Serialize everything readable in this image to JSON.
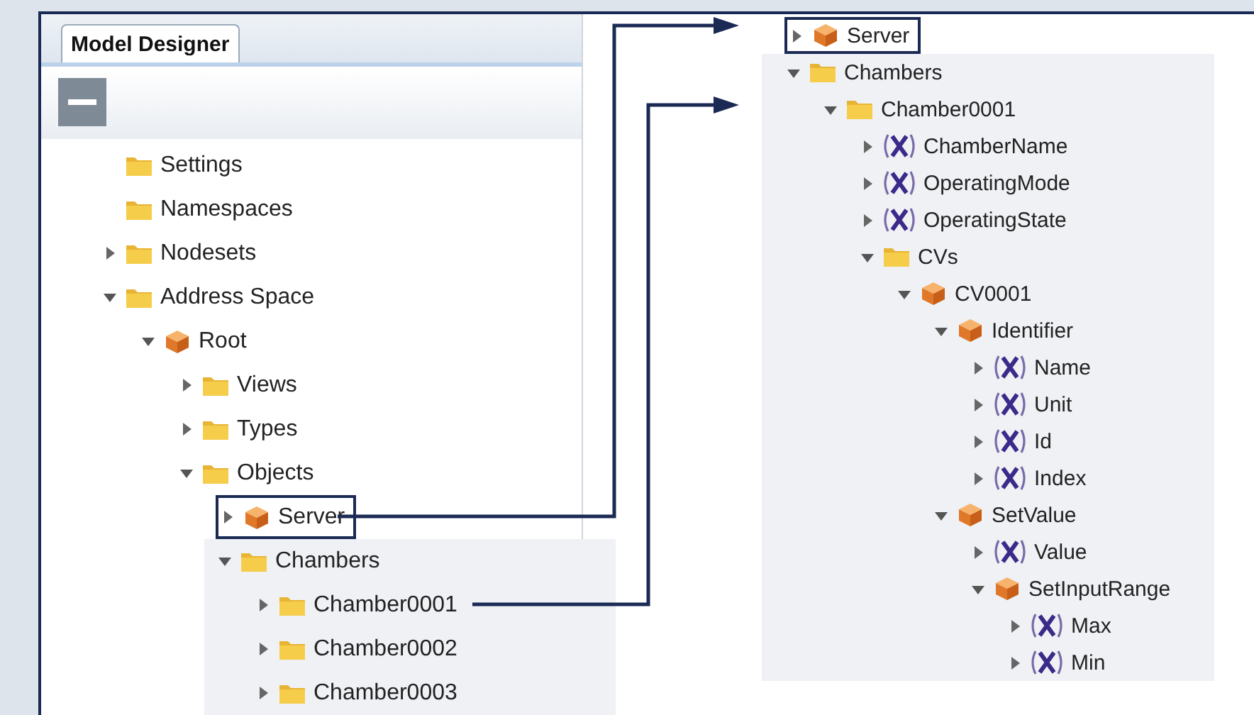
{
  "left_panel": {
    "tab": {
      "label": "Model Designer",
      "selected": true
    },
    "tree": [
      {
        "label": "Settings",
        "kind": "folder"
      },
      {
        "label": "Namespaces",
        "kind": "folder"
      },
      {
        "label": "Nodesets",
        "kind": "folder",
        "expanded": false
      },
      {
        "label": "Address Space",
        "kind": "folder",
        "expanded": true,
        "children": [
          {
            "label": "Root",
            "kind": "object",
            "expanded": true,
            "children": [
              {
                "label": "Views",
                "kind": "folder",
                "expanded": false
              },
              {
                "label": "Types",
                "kind": "folder",
                "expanded": false
              },
              {
                "label": "Objects",
                "kind": "folder",
                "expanded": true,
                "children": [
                  {
                    "label": "Server",
                    "kind": "object",
                    "expanded": false,
                    "highlighted": true
                  },
                  {
                    "label": "Chambers",
                    "kind": "folder",
                    "expanded": true,
                    "shaded": true,
                    "children": [
                      {
                        "label": "Chamber0001",
                        "kind": "folder",
                        "expanded": false
                      },
                      {
                        "label": "Chamber0002",
                        "kind": "folder",
                        "expanded": false
                      },
                      {
                        "label": "Chamber0003",
                        "kind": "folder",
                        "expanded": false
                      }
                    ]
                  }
                ]
              }
            ]
          }
        ]
      }
    ]
  },
  "right_panel": {
    "tree": [
      {
        "label": "Server",
        "kind": "object",
        "expanded": false,
        "highlighted": true
      },
      {
        "label": "Chambers",
        "kind": "folder",
        "expanded": true,
        "shaded": true,
        "children": [
          {
            "label": "Chamber0001",
            "kind": "folder",
            "expanded": true,
            "children": [
              {
                "label": "ChamberName",
                "kind": "variable",
                "expanded": false
              },
              {
                "label": "OperatingMode",
                "kind": "variable",
                "expanded": false
              },
              {
                "label": "OperatingState",
                "kind": "variable",
                "expanded": false
              },
              {
                "label": "CVs",
                "kind": "folder",
                "expanded": true,
                "children": [
                  {
                    "label": "CV0001",
                    "kind": "object",
                    "expanded": true,
                    "children": [
                      {
                        "label": "Identifier",
                        "kind": "object",
                        "expanded": true,
                        "children": [
                          {
                            "label": "Name",
                            "kind": "variable",
                            "expanded": false
                          },
                          {
                            "label": "Unit",
                            "kind": "variable",
                            "expanded": false
                          },
                          {
                            "label": "Id",
                            "kind": "variable",
                            "expanded": false
                          },
                          {
                            "label": "Index",
                            "kind": "variable",
                            "expanded": false
                          }
                        ]
                      },
                      {
                        "label": "SetValue",
                        "kind": "object",
                        "expanded": true,
                        "children": [
                          {
                            "label": "Value",
                            "kind": "variable",
                            "expanded": false
                          },
                          {
                            "label": "SetInputRange",
                            "kind": "object",
                            "expanded": true,
                            "children": [
                              {
                                "label": "Max",
                                "kind": "variable",
                                "expanded": false
                              },
                              {
                                "label": "Min",
                                "kind": "variable",
                                "expanded": false
                              }
                            ]
                          }
                        ]
                      }
                    ]
                  }
                ]
              }
            ]
          }
        ]
      }
    ]
  }
}
